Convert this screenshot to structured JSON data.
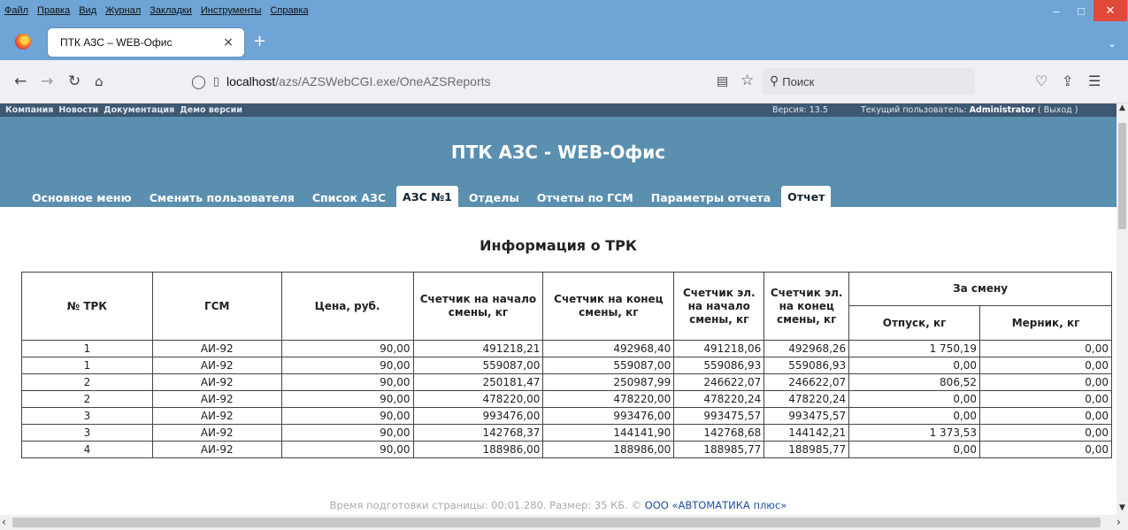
{
  "window": {
    "menu": [
      "Файл",
      "Правка",
      "Вид",
      "Журнал",
      "Закладки",
      "Инструменты",
      "Справка"
    ],
    "minimize": "–",
    "maximize": "□",
    "close": "✕"
  },
  "browser": {
    "tab_title": "ПТК АЗС – WEB-Офис",
    "tab_close": "×",
    "new_tab": "+",
    "list_tabs": "⌄",
    "url_host": "localhost",
    "url_path": "/azs/AZSWebCGI.exe/OneAZSReports",
    "search_placeholder": "Поиск"
  },
  "site": {
    "top_links": [
      "Компания",
      "Новости",
      "Документация",
      "Демо версии"
    ],
    "version": "Версия: 13.5",
    "user_label": "Текущий пользователь:",
    "user_name": "Administrator",
    "logout": "( Выход )",
    "title": "ПТК АЗС - WEB-Офис",
    "tabs": [
      "Основное меню",
      "Сменить пользователя",
      "Список АЗС",
      "АЗС №1",
      "Отделы",
      "Отчеты по ГСМ",
      "Параметры отчета",
      "Отчет"
    ],
    "active_tabs": [
      "АЗС №1",
      "Отчет"
    ]
  },
  "report": {
    "title": "Информация о ТРК",
    "headers": {
      "trk": "№ ТРК",
      "gsm": "ГСМ",
      "price": "Цена, руб.",
      "cnt_start": "Счетчик на начало смены, кг",
      "cnt_end": "Счетчик на конец смены, кг",
      "el_start": "Счетчик эл. на начало смены, кг",
      "el_end": "Счетчик эл. на конец смены, кг",
      "per_shift": "За смену",
      "release": "Отпуск, кг",
      "merник": "Мерник, кг"
    },
    "rows": [
      [
        "1",
        "АИ-92",
        "90,00",
        "491218,21",
        "492968,40",
        "491218,06",
        "492968,26",
        "1 750,19",
        "0,00"
      ],
      [
        "1",
        "АИ-92",
        "90,00",
        "559087,00",
        "559087,00",
        "559086,93",
        "559086,93",
        "0,00",
        "0,00"
      ],
      [
        "2",
        "АИ-92",
        "90,00",
        "250181,47",
        "250987,99",
        "246622,07",
        "246622,07",
        "806,52",
        "0,00"
      ],
      [
        "2",
        "АИ-92",
        "90,00",
        "478220,00",
        "478220,00",
        "478220,24",
        "478220,24",
        "0,00",
        "0,00"
      ],
      [
        "3",
        "АИ-92",
        "90,00",
        "993476,00",
        "993476,00",
        "993475,57",
        "993475,57",
        "0,00",
        "0,00"
      ],
      [
        "3",
        "АИ-92",
        "90,00",
        "142768,37",
        "144141,90",
        "142768,68",
        "144142,21",
        "1 373,53",
        "0,00"
      ],
      [
        "4",
        "АИ-92",
        "90,00",
        "188986,00",
        "188986,00",
        "188985,77",
        "188985,77",
        "0,00",
        "0,00"
      ]
    ]
  },
  "footer": {
    "text": "Время подготовки страницы: 00:01.280. Размер: 35 КБ. ©",
    "link": "ООО «АВТОМАТИКА плюс»"
  }
}
